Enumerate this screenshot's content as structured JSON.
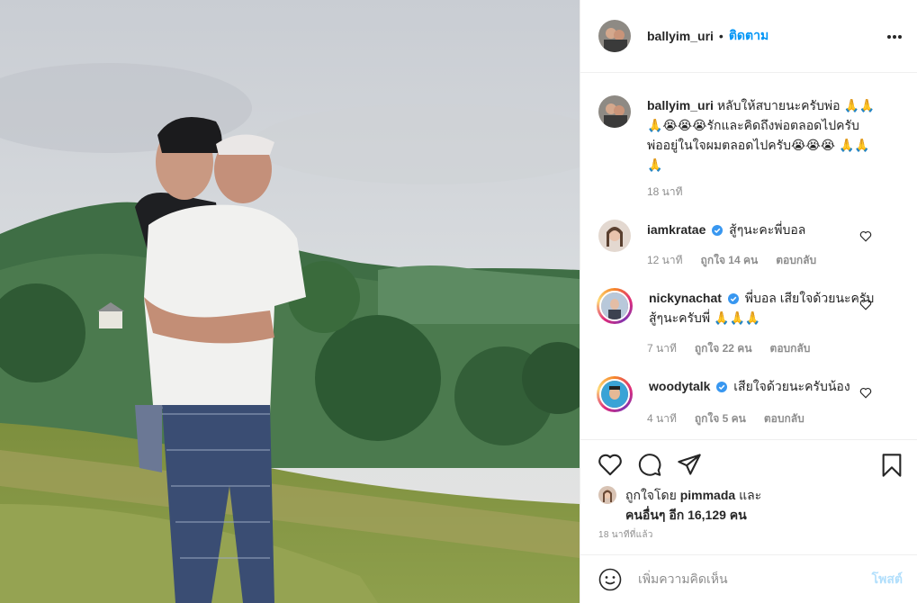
{
  "post": {
    "username": "ballyim_uri",
    "separator": "•",
    "follow_label": "ติดตาม",
    "more_label": "•••"
  },
  "caption": {
    "username": "ballyim_uri",
    "text": "หลับให้สบายนะครับพ่อ 🙏🙏🙏😭😭😭รักและคิดถึงพ่อตลอดไปครับ พ่ออยู่ในใจผมตลอดไปครับ😭😭😭 🙏🙏🙏",
    "time": "18 นาที"
  },
  "comments": [
    {
      "username": "iamkratae",
      "verified": true,
      "text": "สู้ๆนะคะพี่บอล",
      "time": "12 นาที",
      "likes": "ถูกใจ 14 คน",
      "reply": "ตอบกลับ"
    },
    {
      "username": "nickynachat",
      "verified": true,
      "text": "พี่บอล เสียใจด้วยนะครับ สู้ๆนะครับพี่ 🙏🙏🙏",
      "time": "7 นาที",
      "likes": "ถูกใจ 22 คน",
      "reply": "ตอบกลับ"
    },
    {
      "username": "woodytalk",
      "verified": true,
      "text": "เสียใจด้วยนะครับน้อง",
      "time": "4 นาที",
      "likes": "ถูกใจ 5 คน",
      "reply": "ตอบกลับ"
    }
  ],
  "likes": {
    "prefix": "ถูกใจโดย",
    "user": "pimmada",
    "and": "และ",
    "others": "คนอื่นๆ อีก 16,129 คน"
  },
  "posted_time": "18 นาทีที่แล้ว",
  "add_comment": {
    "placeholder": "เพิ่มความคิดเห็น",
    "post_label": "โพสต์"
  },
  "icons": {
    "like": "heart-icon",
    "comment": "comment-icon",
    "share": "share-icon",
    "save": "bookmark-icon",
    "emoji": "emoji-icon",
    "more": "more-icon"
  },
  "colors": {
    "accent": "#0095f6",
    "verified": "#3897f0",
    "muted": "#8e8e8e",
    "post_disabled": "#b2dffc"
  }
}
